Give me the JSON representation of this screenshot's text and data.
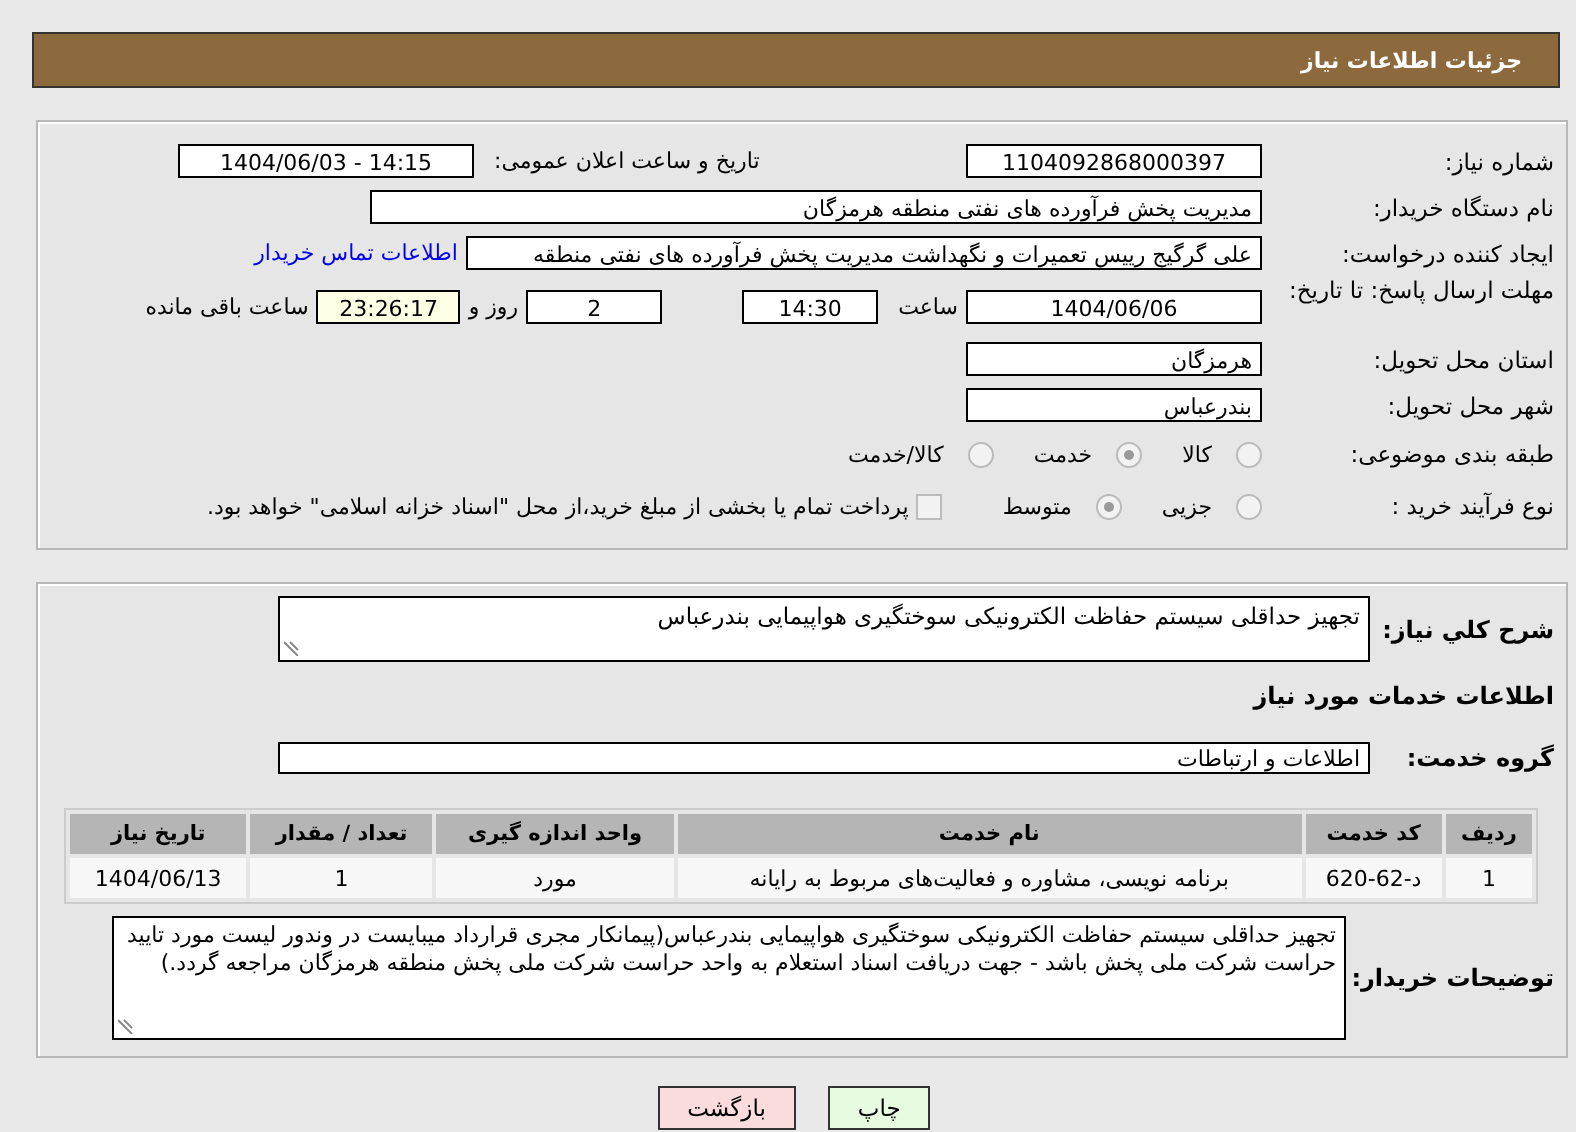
{
  "header": {
    "title": "جزئیات اطلاعات نیاز"
  },
  "need_number": {
    "label": "شماره نیاز:",
    "value": "1104092868000397"
  },
  "announcement": {
    "label": "تاریخ و ساعت اعلان عمومی:",
    "value": "1404/06/03 - 14:15"
  },
  "buyer": {
    "label": "نام دستگاه خریدار:",
    "value": "مدیریت پخش فرآورده های نفتی منطقه هرمزگان"
  },
  "requester": {
    "label": "ایجاد کننده درخواست:",
    "value": "علی گرگیج رییس تعمیرات و نگهداشت مدیریت پخش فرآورده های نفتی منطقه",
    "contact_link": "اطلاعات تماس خریدار"
  },
  "deadline": {
    "label": "مهلت ارسال پاسخ: تا تاریخ:",
    "date": "1404/06/06",
    "time_label": "ساعت",
    "time": "14:30",
    "days": "2",
    "days_label": "روز و",
    "remaining": "23:26:17",
    "remaining_label": "ساعت باقی مانده"
  },
  "province": {
    "label": "استان محل تحویل:",
    "value": "هرمزگان"
  },
  "city": {
    "label": "شهر محل تحویل:",
    "value": "بندرعباس"
  },
  "classification": {
    "label": "طبقه بندی موضوعی:",
    "options": [
      {
        "label": "کالا",
        "selected": false
      },
      {
        "label": "خدمت",
        "selected": true
      },
      {
        "label": "کالا/خدمت",
        "selected": false
      }
    ]
  },
  "purchase_process": {
    "label": "نوع فرآیند خرید :",
    "options": [
      {
        "label": "جزیی",
        "selected": false
      },
      {
        "label": "متوسط",
        "selected": true
      }
    ],
    "treasury_payment": {
      "checked": false,
      "text": "پرداخت تمام یا بخشی از مبلغ خرید،از محل \"اسناد خزانه اسلامی\" خواهد بود."
    }
  },
  "description": {
    "label": "شرح کلي نياز:",
    "value": "تجهیز حداقلی سیستم حفاظت الکترونیکی سوختگیری هواپیمایی بندرعباس"
  },
  "services_heading": "اطلاعات خدمات مورد نیاز",
  "service_group": {
    "label": "گروه خدمت:",
    "value": "اطلاعات و ارتباطات"
  },
  "table": {
    "columns": [
      "ردیف",
      "کد خدمت",
      "نام خدمت",
      "واحد اندازه گیری",
      "تعداد / مقدار",
      "تاریخ نیاز"
    ],
    "rows": [
      [
        "1",
        "د-62-620",
        "برنامه نویسی، مشاوره و فعالیت‌های مربوط به رایانه",
        "مورد",
        "1",
        "1404/06/13"
      ]
    ]
  },
  "buyer_notes": {
    "label": "توضیحات خریدار:",
    "value": "تجهیز حداقلی سیستم حفاظت الکترونیکی سوختگیری هواپیمایی بندرعباس(پیمانکار مجری قرارداد میبایست در وندور لیست مورد تایید حراست شرکت ملی پخش باشد - جهت دریافت اسناد استعلام به واحد حراست شرکت ملی پخش منطقه هرمزگان مراجعه گردد.)"
  },
  "buttons": [
    {
      "label": "چاپ",
      "kind": "print"
    },
    {
      "label": "بازگشت",
      "kind": "back"
    }
  ]
}
